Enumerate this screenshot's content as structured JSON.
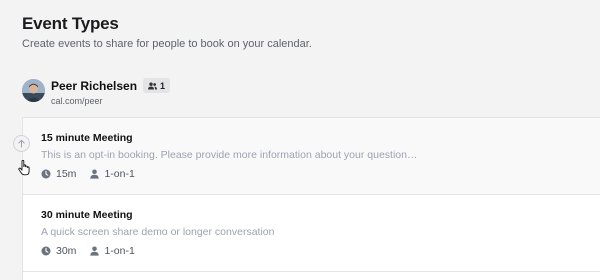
{
  "header": {
    "title": "Event Types",
    "subtitle": "Create events to share for people to book on your calendar."
  },
  "profile": {
    "name": "Peer Richelsen",
    "member_count": "1",
    "url": "cal.com/peer"
  },
  "event_types": [
    {
      "title": "15 minute Meeting",
      "description": "This is an opt-in booking. Please provide more information about your question…",
      "duration": "15m",
      "type": "1-on-1"
    },
    {
      "title": "30 minute Meeting",
      "description": "A quick screen share demo or longer conversation",
      "duration": "30m",
      "type": "1-on-1"
    }
  ],
  "icons": {
    "members": "users-icon",
    "duration": "clock-icon",
    "type": "user-icon",
    "reorder": "arrow-up-icon",
    "cursor": "hand-pointer-icon"
  }
}
